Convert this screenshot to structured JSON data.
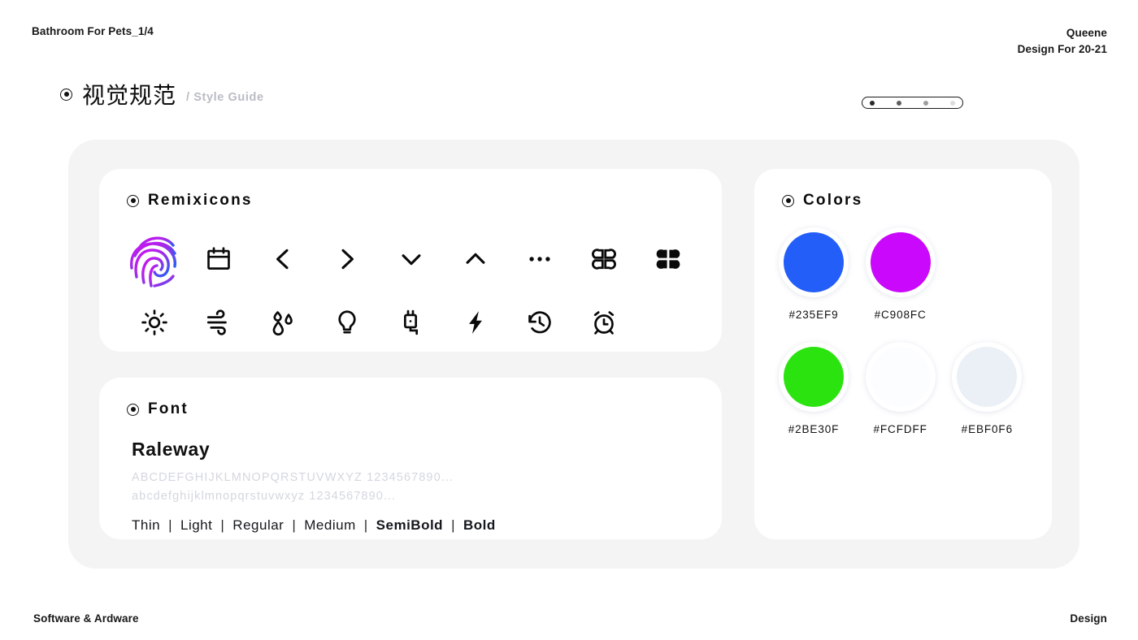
{
  "header": {
    "left_label": "Bathroom For Pets_1/4",
    "author": "Queene",
    "subtitle": "Design For 20-21"
  },
  "title": {
    "cn": "视觉规范",
    "en": "/ Style Guide"
  },
  "pager": {
    "dots": 4,
    "active_index": 0
  },
  "icons_card": {
    "heading": "Remixicons",
    "items": [
      {
        "name": "fingerprint-icon",
        "label": "Fingerprint"
      },
      {
        "name": "calendar-icon",
        "label": "Calendar"
      },
      {
        "name": "chevron-left-icon",
        "label": "Arrow Left"
      },
      {
        "name": "chevron-right-icon",
        "label": "Arrow Right"
      },
      {
        "name": "chevron-down-icon",
        "label": "Arrow Down"
      },
      {
        "name": "chevron-up-icon",
        "label": "Arrow Up"
      },
      {
        "name": "more-dots-icon",
        "label": "More"
      },
      {
        "name": "clover-grid-outline-icon",
        "label": "Function Line"
      },
      {
        "name": "clover-grid-filled-icon",
        "label": "Function Fill"
      },
      {
        "name": "sun-icon",
        "label": "Sun"
      },
      {
        "name": "wind-icon",
        "label": "Wind"
      },
      {
        "name": "water-drops-icon",
        "label": "Drops"
      },
      {
        "name": "lightbulb-icon",
        "label": "Lightbulb"
      },
      {
        "name": "plug-icon",
        "label": "Plug"
      },
      {
        "name": "flash-icon",
        "label": "Flash"
      },
      {
        "name": "history-icon",
        "label": "History"
      },
      {
        "name": "alarm-clock-icon",
        "label": "Alarm"
      }
    ]
  },
  "font_card": {
    "heading": "Font",
    "family": "Raleway",
    "uppercase_sample": "ABCDEFGHIJKLMNOPQRSTUVWXYZ 1234567890...",
    "lowercase_sample": "abcdefghijklmnopqrstuvwxyz 1234567890...",
    "weights": [
      "Thin",
      "Light",
      "Regular",
      "Medium",
      "SemiBold",
      "Bold"
    ],
    "weight_separator": "|"
  },
  "colors_card": {
    "heading": "Colors",
    "swatches": [
      {
        "code": "#235EF9",
        "hex": "#235EF9"
      },
      {
        "code": "#C908FC",
        "hex": "#C908FC"
      },
      {
        "code": "#2BE30F",
        "hex": "#2BE30F"
      },
      {
        "code": "#FCFDFF",
        "hex": "#FCFDFF"
      },
      {
        "code": "#EBF0F6",
        "hex": "#EBF0F6"
      }
    ]
  },
  "footer": {
    "left_label": "Software & Ardware",
    "right_label": "Design"
  },
  "theme": {
    "panel_bg": "#F4F4F4",
    "card_bg": "#FFFFFF",
    "text": "#111111",
    "muted": "#D3D7DF",
    "gradient_start": "#C908FC",
    "gradient_end": "#235EF9"
  }
}
